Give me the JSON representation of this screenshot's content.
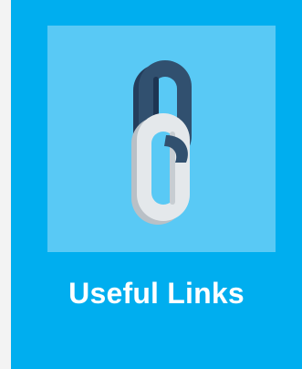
{
  "card": {
    "label": "Useful Links",
    "icon": "chain-link-icon"
  },
  "colors": {
    "page_background": "#f3f3f3",
    "card_background": "#00aeef",
    "icon_tile": "#59c9f5",
    "link_dark": "#2b4566",
    "link_light": "#dfe3e6",
    "label_text": "#ffffff"
  }
}
